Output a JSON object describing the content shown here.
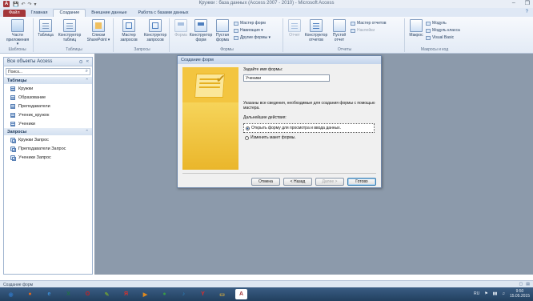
{
  "window": {
    "title": "Кружки : база данных (Access 2007 - 2010) - Microsoft Access",
    "app_icon": "A",
    "qat": [
      "💾",
      "↶",
      "↷",
      "▾"
    ],
    "controls": [
      "–",
      "❐"
    ]
  },
  "ribbon": {
    "tabs": [
      {
        "label": "Файл",
        "kind": "file"
      },
      {
        "label": "Главная",
        "kind": ""
      },
      {
        "label": "Создание",
        "kind": "active"
      },
      {
        "label": "Внешние данные",
        "kind": ""
      },
      {
        "label": "Работа с базами данных",
        "kind": ""
      }
    ],
    "groups": {
      "templates": {
        "label": "Шаблоны",
        "app_parts": "Части приложения ▾"
      },
      "tables": {
        "label": "Таблицы",
        "table": "Таблица",
        "table_designer": "Конструктор таблиц",
        "sharepoint": "Списки SharePoint ▾"
      },
      "queries": {
        "label": "Запросы",
        "wizard": "Мастер запросов",
        "designer": "Конструктор запросов"
      },
      "forms": {
        "label": "Формы",
        "form": "Форма",
        "designer": "Конструктор форм",
        "blank": "Пустая форма",
        "wizard": "Мастер форм",
        "navigation": "Навигация ▾",
        "other": "Другие формы ▾"
      },
      "reports": {
        "label": "Отчеты",
        "report": "Отчет",
        "designer": "Конструктор отчетов",
        "blank": "Пустой отчет",
        "wizard": "Мастер отчетов",
        "labels": "Наклейки"
      },
      "macros": {
        "label": "Макросы и код",
        "macro": "Макрос",
        "module": "Модуль",
        "class_module": "Модуль класса",
        "vb": "Visual Basic"
      }
    }
  },
  "nav": {
    "header": "Все объекты Access",
    "search_placeholder": "Поиск...",
    "groups": [
      {
        "title": "Таблицы",
        "kind": "table",
        "items": [
          "Кружки",
          "Образование",
          "Преподаватели",
          "Ученик_кружок",
          "Ученики"
        ]
      },
      {
        "title": "Запросы",
        "kind": "query",
        "items": [
          "Кружки Запрос",
          "Преподаватели Запрос",
          "Ученики Запрос"
        ]
      }
    ]
  },
  "dialog": {
    "title": "Создание форм",
    "prompt": "Задайте имя формы:",
    "name_value": "Ученики",
    "info": "Указаны все сведения, необходимые для создания формы с помощью мастера.",
    "next_label": "Дальнейшие действия:",
    "options": [
      {
        "label": "Открыть форму для просмотра и ввода данных.",
        "selected": true
      },
      {
        "label": "Изменить макет формы.",
        "selected": false
      }
    ],
    "buttons": {
      "cancel": "Отмена",
      "back": "< Назад",
      "next": "Далее >",
      "finish": "Готово"
    }
  },
  "status": {
    "text": "Создание форм"
  },
  "taskbar": {
    "items": [
      {
        "icon": "windows-start-icon",
        "glyph": "◉",
        "color": "#2f6fb5"
      },
      {
        "icon": "firefox-icon",
        "glyph": "●",
        "color": "#e56a1c"
      },
      {
        "icon": "internet-explorer-icon",
        "glyph": "e",
        "color": "#3b8ed6"
      },
      {
        "icon": "excel-icon",
        "glyph": "X",
        "color": "#1f7244"
      },
      {
        "icon": "opera-icon",
        "glyph": "O",
        "color": "#cc1f1f"
      },
      {
        "icon": "drawing-icon",
        "glyph": "✎",
        "color": "#6a9a3a"
      },
      {
        "icon": "yandex-browser-icon",
        "glyph": "Я",
        "color": "#d9302c"
      },
      {
        "icon": "media-player-icon",
        "glyph": "▶",
        "color": "#e08a1e"
      },
      {
        "icon": "chrome-icon",
        "glyph": "●",
        "color": "#3a9b45"
      },
      {
        "icon": "audio-player-icon",
        "glyph": "♪",
        "color": "#2a87c9"
      },
      {
        "icon": "yandex-icon",
        "glyph": "Y",
        "color": "#e02b2b"
      },
      {
        "icon": "folder-icon",
        "glyph": "▭",
        "color": "#e2b33c"
      },
      {
        "icon": "access-icon",
        "glyph": "A",
        "color": "#a4373a"
      }
    ],
    "clock_time": "9:50",
    "clock_date": "15.05.2015"
  }
}
